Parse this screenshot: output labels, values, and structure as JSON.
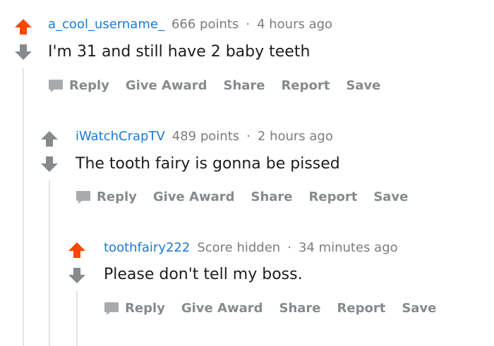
{
  "comments": [
    {
      "author": "a_cool_username_",
      "points": "666 points",
      "separator": "·",
      "time": "4 hours ago",
      "body": "I'm 31 and still have 2 baby teeth",
      "upvoted": true,
      "actions": [
        "Reply",
        "Give Award",
        "Share",
        "Report",
        "Save"
      ]
    },
    {
      "author": "iWatchCrapTV",
      "points": "489 points",
      "separator": "·",
      "time": "2 hours ago",
      "body": "The tooth fairy is gonna be pissed",
      "upvoted": false,
      "actions": [
        "Reply",
        "Give Award",
        "Share",
        "Report",
        "Save"
      ]
    },
    {
      "author": "toothfairy222",
      "points": "Score hidden",
      "separator": "·",
      "time": "34 minutes ago",
      "body": "Please don't tell my boss.",
      "upvoted": true,
      "actions": [
        "Reply",
        "Give Award",
        "Share",
        "Report",
        "Save"
      ]
    }
  ],
  "colors": {
    "upvote_active": "#ff4500",
    "vote_neutral": "#878a8c",
    "author": "#1a7ad6",
    "meta": "#7c7c7c",
    "body": "#1c1c1c",
    "thread_line": "#e1e4e8"
  },
  "icons": {
    "upvote": "upvote-arrow-icon",
    "downvote": "downvote-arrow-icon",
    "reply": "speech-bubble-icon"
  }
}
